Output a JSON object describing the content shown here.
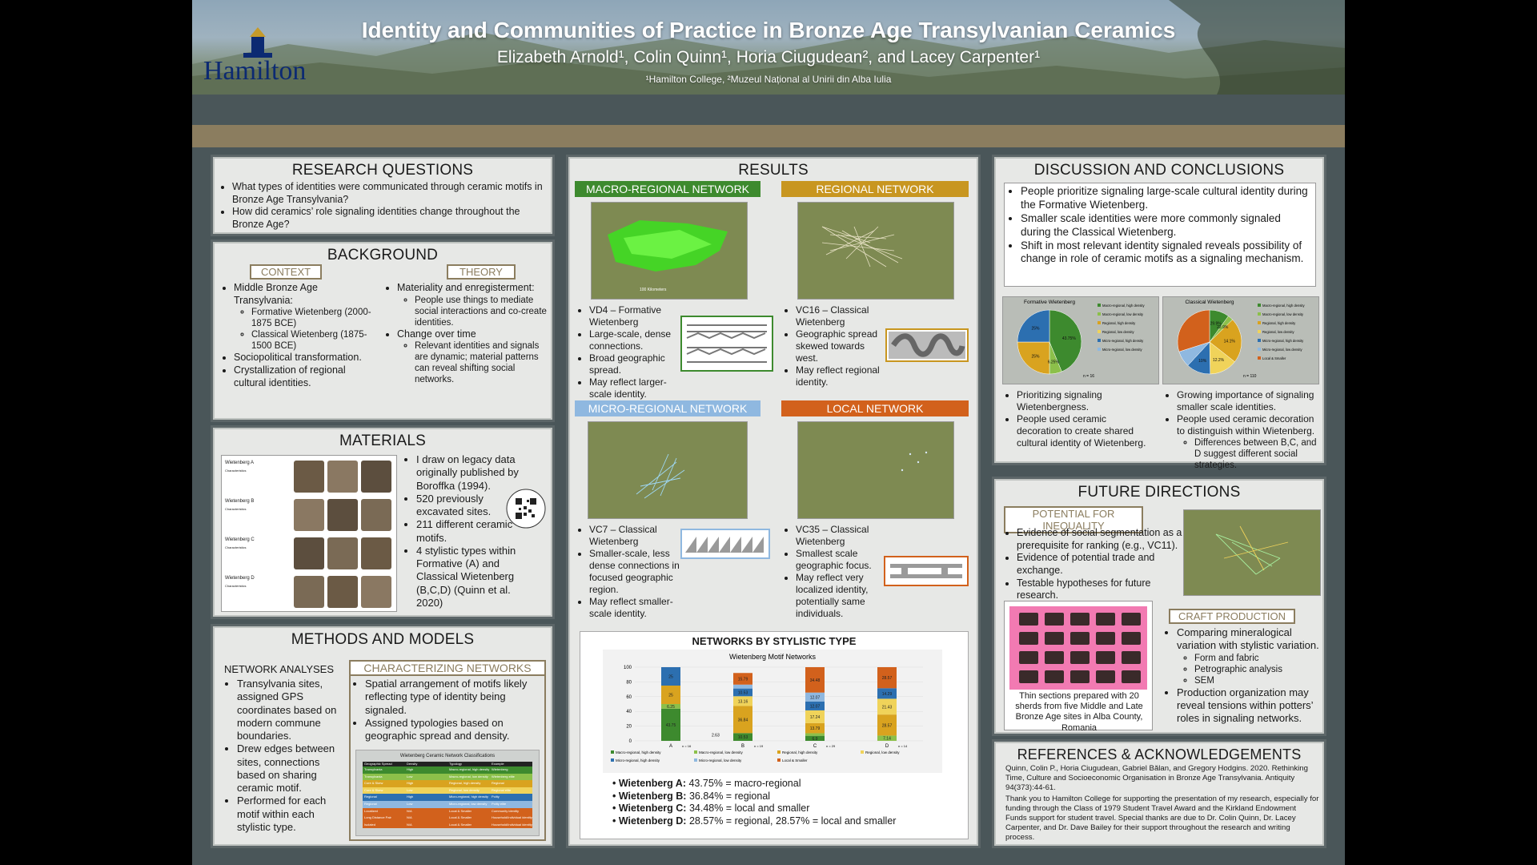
{
  "header": {
    "title": "Identity and Communities of Practice in Bronze Age Transylvanian Ceramics",
    "authors": "Elizabeth Arnold¹, Colin Quinn¹, Horia Ciugudean², and Lacey Carpenter¹",
    "affiliations": "¹Hamilton College, ²Muzeul Național al Unirii din Alba Iulia",
    "logo": "Hamilton"
  },
  "research": {
    "title": "RESEARCH QUESTIONS",
    "items": [
      "What types of identities were communicated through ceramic motifs in Bronze Age Transylvania?",
      "How did ceramics’ role signaling identities change throughout the Bronze Age?"
    ]
  },
  "background": {
    "title": "BACKGROUND",
    "context_label": "CONTEXT",
    "theory_label": "THEORY",
    "ctx1": "Middle Bronze Age Transylvania:",
    "ctx1a": "Formative Wietenberg (2000-1875 BCE)",
    "ctx1b": "Classical Wietenberg (1875-1500 BCE)",
    "ctx2": "Sociopolitical transformation.",
    "ctx3": "Crystallization of regional cultural identities.",
    "th1": "Materiality and enregisterment:",
    "th1a": "People use things to mediate social interactions and co-create identities.",
    "th2": "Change over time",
    "th2a": "Relevant identities and signals are dynamic; material patterns can reveal shifting social networks."
  },
  "materials": {
    "title": "MATERIALS",
    "items": [
      "I draw on legacy data originally published by Boroffka (1994).",
      "520 previously excavated sites.",
      "211 different ceramic motifs.",
      "4 stylistic types within Formative (A) and Classical Wietenberg (B,C,D) (Quinn et al. 2020)"
    ],
    "types": [
      "Wietenberg A",
      "Wietenberg B",
      "Wietenberg C",
      "Wietenberg D"
    ],
    "type_sub": "Characteristics"
  },
  "methods": {
    "title": "METHODS AND MODELS",
    "net_title": "NETWORK ANALYSES",
    "net_items": [
      "Transylvania sites, assigned GPS coordinates based on modern commune boundaries.",
      "Drew edges between sites, connections based on sharing ceramic motif.",
      "Performed for each motif within each stylistic type."
    ],
    "char_title": "CHARACTERIZING NETWORKS",
    "char_items": [
      "Spatial arrangement of motifs likely reflecting type of identity being signaled.",
      "Assigned typologies based on geographic spread and density."
    ],
    "table_title": "Wietenberg Ceramic Network Classifications",
    "table_headers": [
      "Geographic Spread",
      "Density",
      "Typology",
      "Example"
    ],
    "table_rows": [
      [
        "Transylvania",
        "High",
        "Macro-regional, high density",
        "Wietenberg"
      ],
      [
        "Transylvania",
        "Low",
        "Macro-regional, low density",
        "Wietenberg elite"
      ],
      [
        "Core & Skew",
        "High",
        "Regional, high density",
        "Regional"
      ],
      [
        "Core & Skew",
        "Low",
        "Regional, low density",
        "Regional elite"
      ],
      [
        "Regional",
        "High",
        "Micro-regional, high density",
        "Polity"
      ],
      [
        "Regional",
        "Low",
        "Micro-regional, low density",
        "Polity elite"
      ],
      [
        "Localized",
        "N/A",
        "Local & Smaller",
        "Community identity"
      ],
      [
        "Long Distance Pair",
        "N/A",
        "Local & Smaller",
        "Household/Individual identity"
      ],
      [
        "Isolated",
        "N/A",
        "Local & Smaller",
        "Household/Individual identity"
      ]
    ]
  },
  "results": {
    "title": "RESULTS",
    "macro": {
      "label": "MACRO-REGIONAL NETWORK",
      "items": [
        "VD4 – Formative Wietenberg",
        "Large-scale, dense connections.",
        "Broad geographic spread.",
        "May reflect larger-scale identity."
      ]
    },
    "regional": {
      "label": "REGIONAL NETWORK",
      "items": [
        "VC16 – Classical Wietenberg",
        "Geographic spread skewed towards west.",
        "May reflect regional identity."
      ]
    },
    "micro": {
      "label": "MICRO-REGIONAL NETWORK",
      "items": [
        "VC7 – Classical Wietenberg",
        "Smaller-scale, less dense connections in focused geographic region.",
        "May reflect smaller-scale identity."
      ]
    },
    "local": {
      "label": "LOCAL NETWORK",
      "items": [
        "VC35 – Classical Wietenberg",
        "Smallest scale geographic focus.",
        "May reflect very localized identity, potentially same individuals."
      ]
    },
    "map_scale": "100 Kilometers",
    "stylistic_title": "NETWORKS BY STYLISTIC TYPE",
    "summary": [
      {
        "label": "Wietenberg A:",
        "text": "43.75% = macro-regional"
      },
      {
        "label": "Wietenberg B:",
        "text": "36.84% = regional"
      },
      {
        "label": "Wietenberg C:",
        "text": "34.48% = local and smaller"
      },
      {
        "label": "Wietenberg D:",
        "text": "28.57% = regional, 28.57% = local and smaller"
      }
    ]
  },
  "discussion": {
    "title": "DISCUSSION AND CONCLUSIONS",
    "items": [
      "People prioritize signaling large-scale cultural identity during the Formative Wietenberg.",
      "Smaller scale identities were more commonly signaled during the Classical Wietenberg.",
      "Shift in most relevant identity signaled reveals possibility of change in role of ceramic motifs as a signaling mechanism."
    ],
    "left_items": [
      "Prioritizing signaling Wietenbergness.",
      "People used ceramic decoration to create shared cultural identity of Wietenberg."
    ],
    "right_items": [
      "Growing importance of signaling smaller scale identities.",
      "People used ceramic decoration to distinguish within Wietenberg."
    ],
    "right_sub": "Differences between B,C, and D suggest different social strategies."
  },
  "future": {
    "title": "FUTURE DIRECTIONS",
    "ineq_label": "POTENTIAL FOR INEQUALITY",
    "ineq_items": [
      "Evidence of social segmentation as a prerequisite for ranking (e.g., VC11).",
      "Evidence of potential trade and exchange.",
      "Testable hypotheses for future research."
    ],
    "caption": "Thin sections prepared with 20 sherds from five Middle and Late Bronze Age sites in Alba County, Romania",
    "craft_label": "CRAFT PRODUCTION",
    "craft_item1": "Comparing mineralogical variation with stylistic variation.",
    "craft_subs": [
      "Form and fabric",
      "Petrographic analysis",
      "SEM"
    ],
    "craft_item2": "Production organization may reveal tensions within potters’ roles in signaling networks."
  },
  "references": {
    "title": "REFERENCES & ACKNOWLEDGEMENTS",
    "citation": "Quinn, Colin P., Horia Ciugudean, Gabriel Bălan, and Gregory Hodgins. 2020. Rethinking Time, Culture and Socioeconomic Organisation in Bronze Age Transylvania. Antiquity 94(373):44-61.",
    "ack": "Thank you to Hamilton College for supporting the presentation of my research, especially for funding through the Class of 1979 Student Travel Award and the Kirkland Endowment Funds support for student travel. Special thanks are due to Dr. Colin Quinn, Dr. Lacey Carpenter, and Dr. Dave Bailey for their support throughout the research and writing process."
  },
  "colors": {
    "macro_high": "#3d8a2e",
    "macro_low": "#8cc04a",
    "regional_high": "#d9a31f",
    "regional_low": "#f0d35a",
    "micro_high": "#2c6fb0",
    "micro_low": "#8fb8e0",
    "local": "#d2611c"
  },
  "chart_data": [
    {
      "type": "bar",
      "title": "Wietenberg Motif Networks",
      "categories": [
        "A",
        "B",
        "C",
        "D"
      ],
      "ylim": [
        0,
        100
      ],
      "yticks": [
        0,
        20,
        40,
        60,
        80,
        100
      ],
      "counts": [
        "n = 16",
        "n = 19",
        "n = 29",
        "n = 14"
      ],
      "series": [
        {
          "name": "Macro-regional, high density",
          "values": [
            43.75,
            10.53,
            6.9,
            0
          ],
          "labels": [
            "43.75",
            "10.53",
            "6.9",
            ""
          ]
        },
        {
          "name": "Macro-regional, low density",
          "values": [
            6.25,
            0,
            3.45,
            7.14
          ],
          "labels": [
            "6.25",
            "",
            "3.45",
            "7.14"
          ]
        },
        {
          "name": "Regional, high density",
          "values": [
            25,
            36.84,
            13.79,
            28.57
          ],
          "labels": [
            "25",
            "36.84",
            "13.79",
            "28.57"
          ]
        },
        {
          "name": "Regional, low density",
          "values": [
            0,
            13.16,
            17.24,
            21.43
          ],
          "labels": [
            "",
            "13.16",
            "17.24",
            "21.43"
          ]
        },
        {
          "name": "Micro-regional, high density",
          "values": [
            25,
            10.53,
            12.07,
            14.29
          ],
          "labels": [
            "25",
            "10.53",
            "12.07",
            "14.29"
          ]
        },
        {
          "name": "Micro-regional, low density",
          "values": [
            0,
            5.26,
            12.07,
            0
          ],
          "labels": [
            "",
            "5.26",
            "12.07",
            ""
          ]
        },
        {
          "name": "Local & Smaller",
          "values": [
            0,
            15.79,
            34.48,
            28.57
          ],
          "labels": [
            "",
            "15.79",
            "34.48",
            "28.57"
          ]
        }
      ],
      "extra_labels": [
        "2.63"
      ]
    },
    {
      "type": "pie",
      "title": "Formative Wietenberg",
      "count": "n = 16",
      "slices": [
        {
          "name": "Macro-regional, high density",
          "value": 43.75
        },
        {
          "name": "Macro-regional, low density",
          "value": 6.25
        },
        {
          "name": "Regional, high density",
          "value": 25
        },
        {
          "name": "Regional, low density",
          "value": 0
        },
        {
          "name": "Micro-regional, high density",
          "value": 25
        },
        {
          "name": "Micro-regional, low density",
          "value": 0
        }
      ],
      "slice_labels": [
        "43.75%",
        "6.25%",
        "25%",
        "25%"
      ]
    },
    {
      "type": "pie",
      "title": "Classical Wietenberg",
      "count": "n = 110",
      "slices": [
        {
          "name": "Macro-regional, high density",
          "value": 10
        },
        {
          "name": "Macro-regional, low density",
          "value": 2.7
        },
        {
          "name": "Regional, high density",
          "value": 22.9
        },
        {
          "name": "Regional, low density",
          "value": 14.1
        },
        {
          "name": "Micro-regional, high density",
          "value": 12.2
        },
        {
          "name": "Micro-regional, low density",
          "value": 8.2
        },
        {
          "name": "Local & Smaller",
          "value": 29.9
        }
      ],
      "slice_labels": [
        "29.9%",
        "22.9%",
        "14.1%",
        "12.2%",
        "10%"
      ]
    }
  ]
}
